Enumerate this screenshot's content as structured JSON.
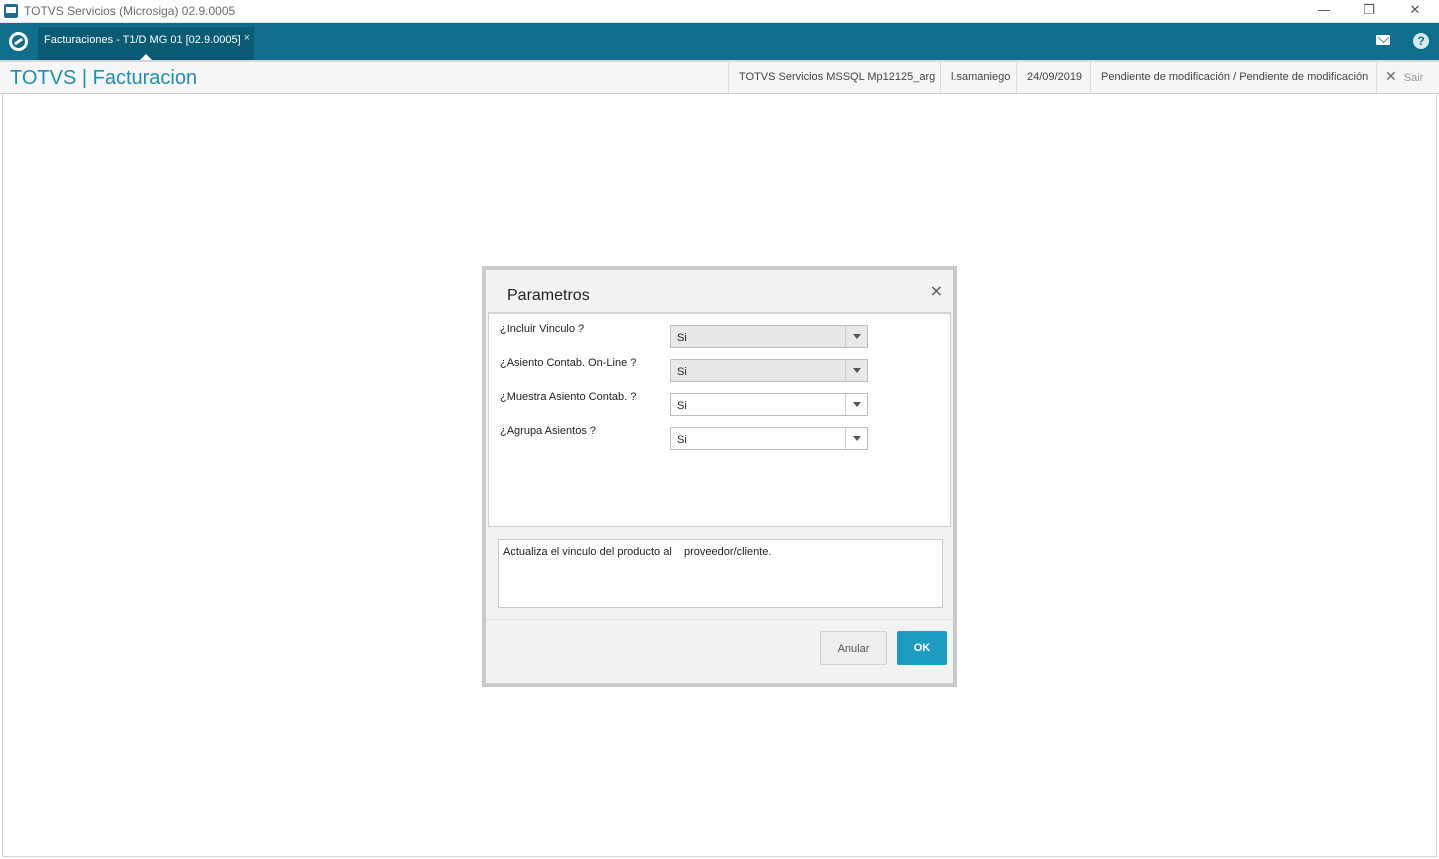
{
  "window": {
    "title": "TOTVS Servicios (Microsiga) 02.9.0005",
    "minimize_glyph": "—",
    "restore_glyph": "❐",
    "close_glyph": "✕"
  },
  "tabbar": {
    "logo_icon": "totvs-logo-icon",
    "tab_label": "Facturaciones - T1/D MG 01  [02.9.0005]",
    "tab_close": "×",
    "mail_icon": "mail-icon",
    "help_icon": "?"
  },
  "header": {
    "app_title": "TOTVS | Facturacion",
    "environment": "TOTVS Servicios MSSQL Mp12125_arg",
    "user": "l.samaniego",
    "date": "24/09/2019",
    "status": "Pendiente de modificación / Pendiente de modificación",
    "exit_icon": "✕",
    "exit_label": "Sair"
  },
  "dialog": {
    "title": "Parametros",
    "close": "×",
    "params": [
      {
        "label": "¿Incluir Vinculo ?",
        "value": "Si",
        "disabled": true
      },
      {
        "label": "¿Asiento Contab. On-Line ?",
        "value": "Si",
        "disabled": true
      },
      {
        "label": "¿Muestra Asiento Contab. ?",
        "value": "Si",
        "disabled": false
      },
      {
        "label": "¿Agrupa Asientos ?",
        "value": "Si",
        "disabled": false
      }
    ],
    "help_text": "Actualiza el vinculo del producto al    proveedor/cliente.",
    "cancel_label": "Anular",
    "ok_label": "OK"
  },
  "colors": {
    "brand": "#0e6e8c",
    "accent": "#1d9cc2",
    "title": "#1d8fb0"
  }
}
